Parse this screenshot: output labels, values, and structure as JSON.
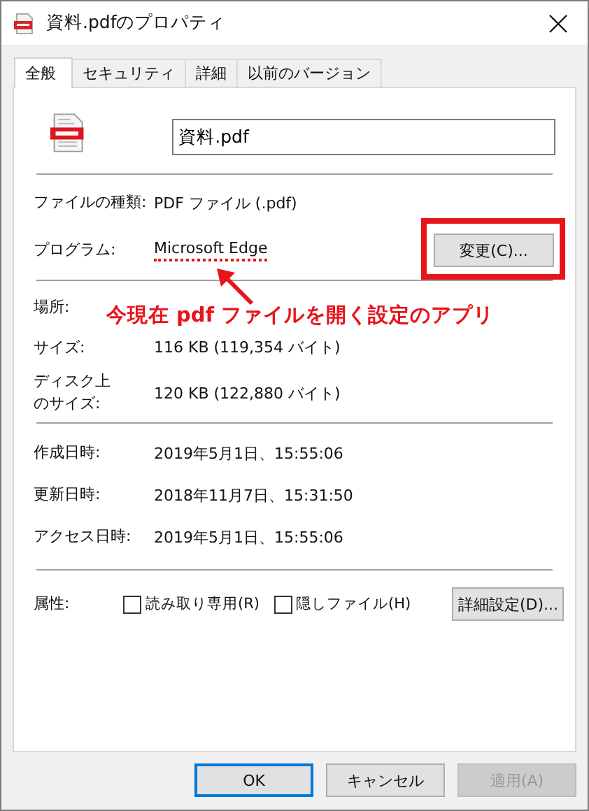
{
  "window": {
    "title": "資料.pdfのプロパティ"
  },
  "tabs": [
    {
      "label": "全般",
      "selected": true
    },
    {
      "label": "セキュリティ",
      "selected": false
    },
    {
      "label": "詳細",
      "selected": false
    },
    {
      "label": "以前のバージョン",
      "selected": false
    }
  ],
  "file_name": "資料.pdf",
  "sections": [
    [
      {
        "kind": "text",
        "label": "ファイルの種類:",
        "value": "PDF ファイル (.pdf)"
      },
      {
        "kind": "program",
        "label": "プログラム:",
        "value": "Microsoft Edge",
        "button": "変更(C)..."
      }
    ],
    [
      {
        "kind": "text",
        "label": "場所:"
      },
      {
        "kind": "text",
        "label": "サイズ:",
        "value": "116 KB (119,354 バイト)"
      },
      {
        "kind": "text",
        "label": [
          "ディスク上",
          "のサイズ:"
        ],
        "value": "120 KB (122,880 バイト)"
      }
    ],
    [
      {
        "kind": "text",
        "label": "作成日時:",
        "value": "2019年5月1日、15:55:06"
      },
      {
        "kind": "text",
        "label": "更新日時:",
        "value": "2018年11月7日、15:31:50"
      },
      {
        "kind": "text",
        "label": "アクセス日時:",
        "value": "2019年5月1日、15:55:06"
      }
    ]
  ],
  "attributes": {
    "label": "属性:",
    "checkboxes": [
      {
        "label": "読み取り専用(R)",
        "checked": false
      },
      {
        "label": "隠しファイル(H)",
        "checked": false
      }
    ],
    "button": "詳細設定(D)..."
  },
  "annotation": {
    "text": "今現在 pdf ファイルを開く設定のアプリ"
  },
  "buttons": [
    {
      "label": "OK",
      "kind": "default",
      "disabled": false
    },
    {
      "label": "キャンセル",
      "kind": "normal",
      "disabled": false
    },
    {
      "label": "適用(A)",
      "kind": "normal",
      "disabled": true
    }
  ]
}
